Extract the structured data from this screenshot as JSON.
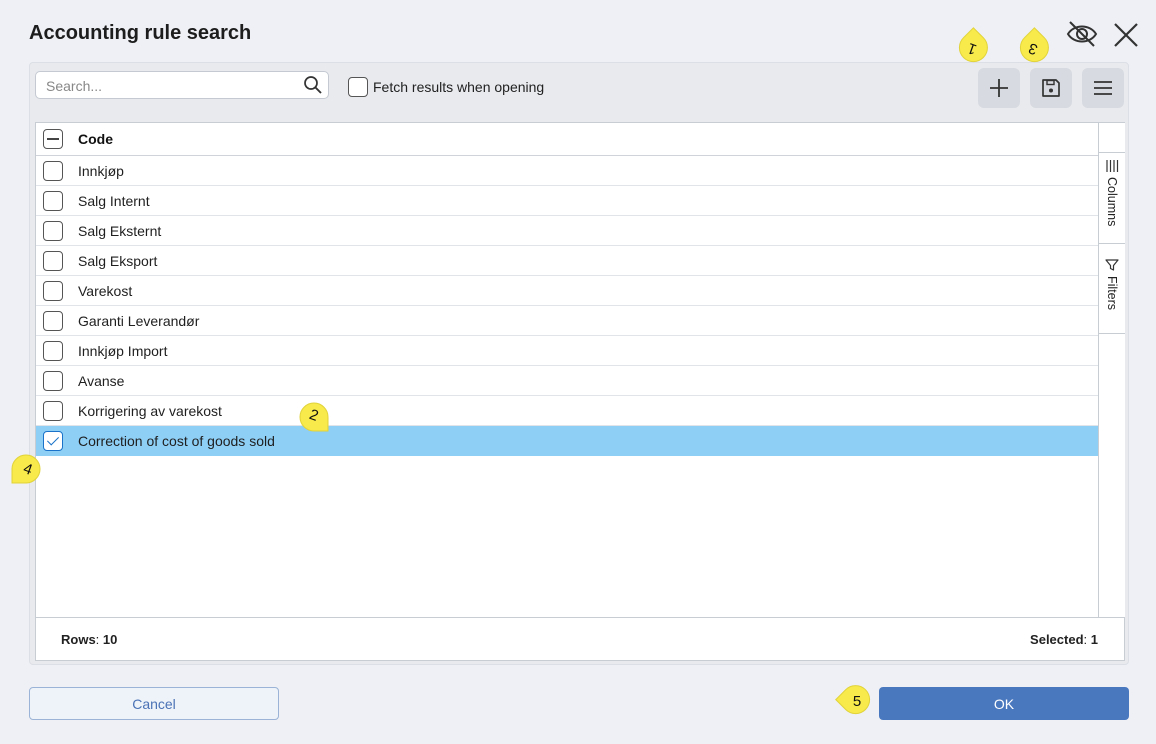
{
  "dialog": {
    "title": "Accounting rule search"
  },
  "toolbar": {
    "search_placeholder": "Search...",
    "search_value": "",
    "fetch_label": "Fetch results when opening",
    "fetch_checked": false
  },
  "grid": {
    "column_header": "Code",
    "rows": [
      {
        "code": "Innkjøp",
        "checked": false
      },
      {
        "code": "Salg Internt",
        "checked": false
      },
      {
        "code": "Salg Eksternt",
        "checked": false
      },
      {
        "code": "Salg Eksport",
        "checked": false
      },
      {
        "code": "Varekost",
        "checked": false
      },
      {
        "code": "Garanti Leverandør",
        "checked": false
      },
      {
        "code": "Innkjøp Import",
        "checked": false
      },
      {
        "code": "Avanse",
        "checked": false
      },
      {
        "code": "Korrigering av varekost",
        "checked": false
      },
      {
        "code": "Correction of cost of goods sold",
        "checked": true
      }
    ],
    "side_tabs": {
      "columns": "Columns",
      "filters": "Filters"
    },
    "footer": {
      "rows_label": "Rows",
      "rows_count": "10",
      "selected_label": "Selected",
      "selected_count": "1"
    }
  },
  "buttons": {
    "cancel": "Cancel",
    "ok": "OK"
  },
  "callouts": [
    "1",
    "2",
    "3",
    "4",
    "5"
  ],
  "colors": {
    "selected_row": "#8ecff6",
    "ok_button": "#4a78bf",
    "callout": "#f7ea4a"
  }
}
